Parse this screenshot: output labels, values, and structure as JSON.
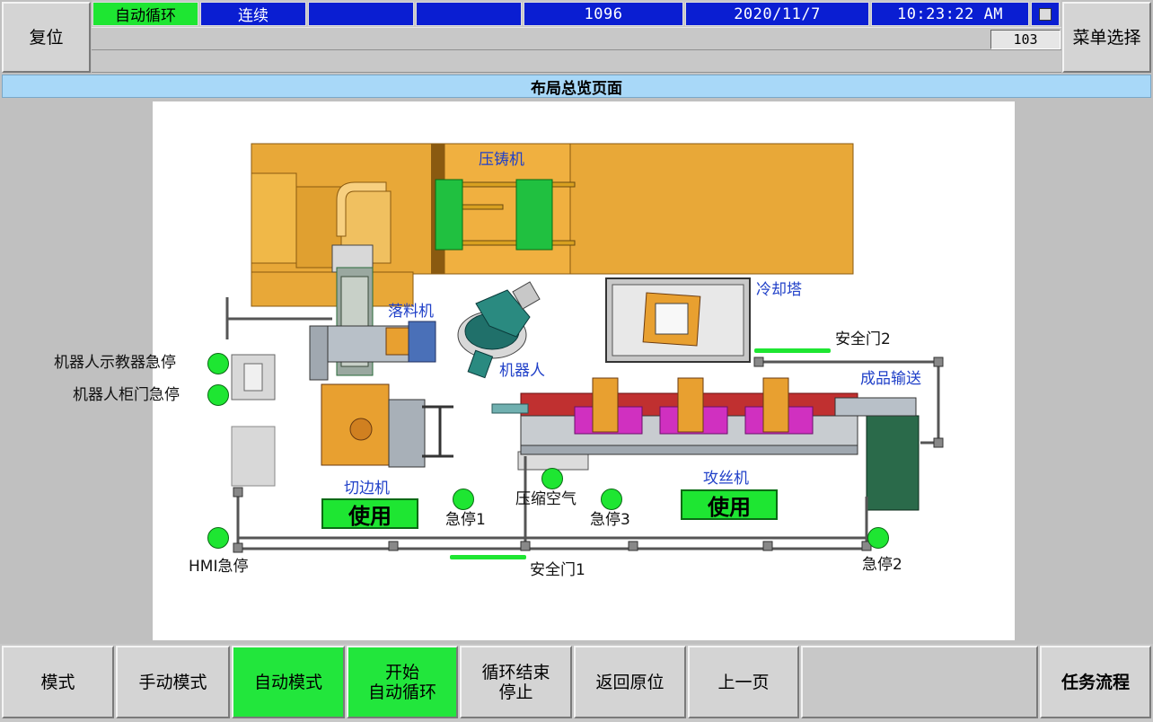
{
  "header": {
    "reset_label": "复位",
    "menu_label": "菜单选择",
    "status_mode": "自动循环",
    "status_run": "连续",
    "status_blank1": "",
    "status_blank2": "",
    "counter": "1096",
    "date": "2020/11/7",
    "time": "10:23:22 AM",
    "sub_counter": "103"
  },
  "page_title": "布局总览页面",
  "layout": {
    "die_casting": "压铸机",
    "unloader": "落料机",
    "robot": "机器人",
    "cooling_tower": "冷却塔",
    "safety_door_2": "安全门2",
    "finished_conveyor": "成品输送",
    "robot_teach_estop": "机器人示教器急停",
    "robot_cabinet_estop": "机器人柜门急停",
    "trimming": "切边机",
    "trimming_use": "使用",
    "estop_1": "急停1",
    "compressed_air": "压缩空气",
    "estop_3": "急停3",
    "tapping": "攻丝机",
    "tapping_use": "使用",
    "hmi_estop": "HMI急停",
    "safety_door_1": "安全门1",
    "estop_2": "急停2"
  },
  "footer": {
    "mode": "模式",
    "manual_mode": "手动模式",
    "auto_mode": "自动模式",
    "start_cycle_line1": "开始",
    "start_cycle_line2": "自动循环",
    "cycle_end_line1": "循环结束",
    "cycle_end_line2": "停止",
    "return_home": "返回原位",
    "prev_page": "上一页",
    "task_flow": "任务流程"
  },
  "colors": {
    "status_blue": "#0a1ed2",
    "indicator_green": "#1ee632",
    "title_bar": "#a8d8f8",
    "machine_orange": "#e8a838",
    "panel_gray": "#c0c0c0"
  }
}
